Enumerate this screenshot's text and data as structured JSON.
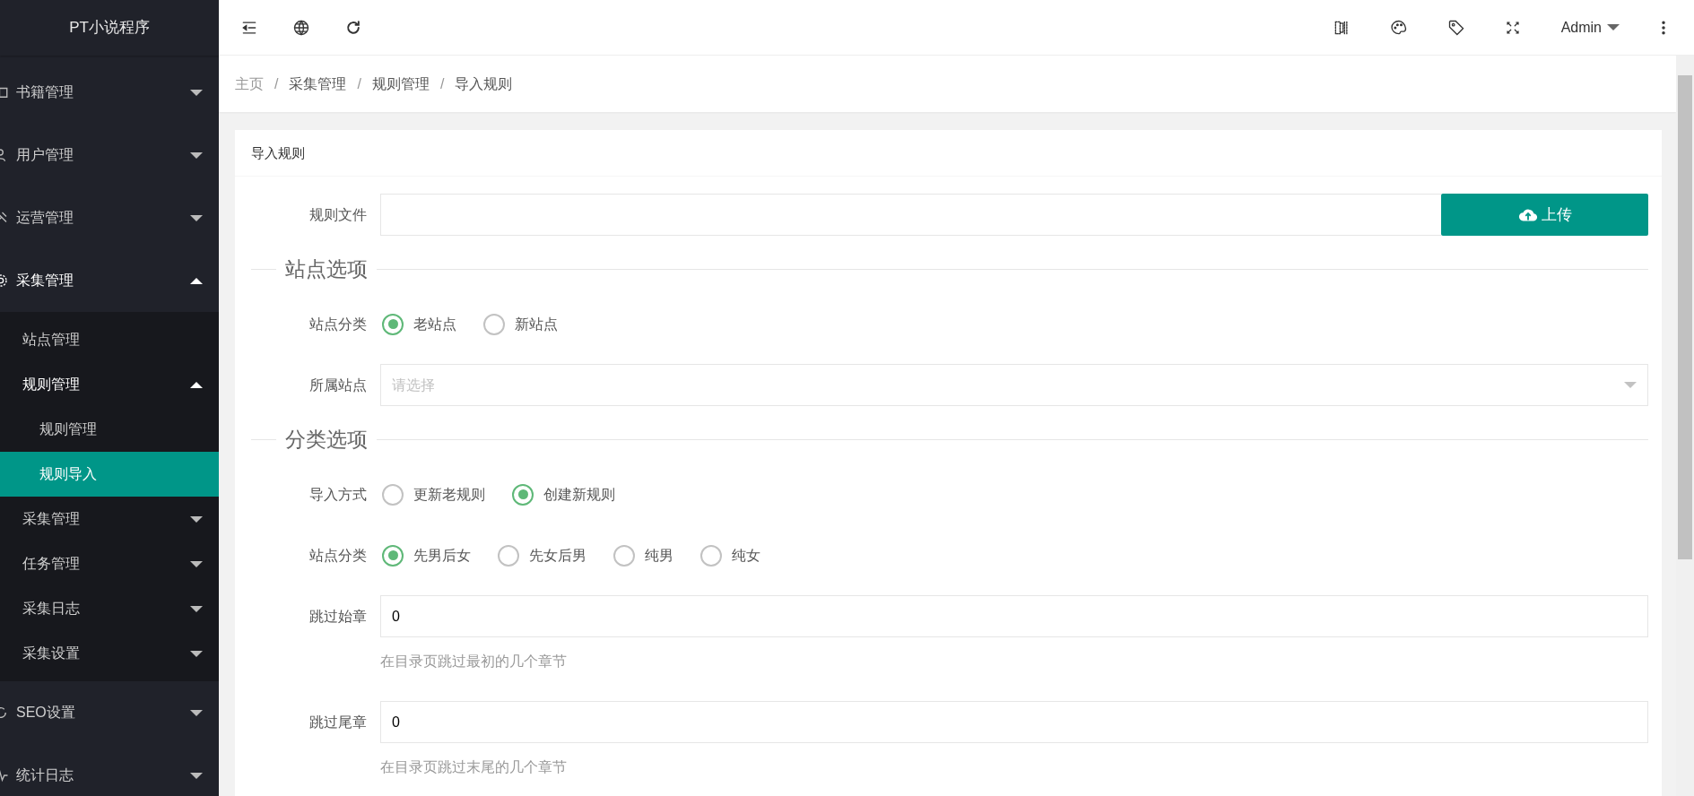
{
  "sidebar": {
    "title": "PT小说程序",
    "items": [
      {
        "label": "书籍管理",
        "expanded": false
      },
      {
        "label": "用户管理",
        "expanded": false
      },
      {
        "label": "运营管理",
        "expanded": false
      },
      {
        "label": "采集管理",
        "expanded": true,
        "children": [
          {
            "label": "站点管理",
            "selected": false
          },
          {
            "label": "规则管理",
            "expanded": true,
            "selected": false,
            "children": [
              {
                "label": "规则管理",
                "selected": false
              },
              {
                "label": "规则导入",
                "selected": true
              }
            ]
          },
          {
            "label": "采集管理",
            "expanded": false,
            "selected": false
          },
          {
            "label": "任务管理",
            "expanded": false,
            "selected": false
          },
          {
            "label": "采集日志",
            "expanded": false,
            "selected": false
          },
          {
            "label": "采集设置",
            "expanded": false,
            "selected": false
          }
        ]
      },
      {
        "label": "SEO设置",
        "expanded": false
      },
      {
        "label": "统计日志",
        "expanded": false
      }
    ]
  },
  "topbar": {
    "user": "Admin"
  },
  "breadcrumb": [
    {
      "label": "主页"
    },
    {
      "separator": "/",
      "label": "采集管理"
    },
    {
      "separator": "/",
      "label": "规则管理"
    },
    {
      "separator": "/",
      "label": "导入规则"
    }
  ],
  "card": {
    "title": "导入规则",
    "rows": [
      {
        "kind": "upload",
        "label": "规则文件",
        "button": "上传"
      },
      {
        "kind": "section",
        "label": "站点选项"
      },
      {
        "kind": "radio",
        "label": "站点分类",
        "options": [
          {
            "label": "老站点",
            "selected": true
          },
          {
            "label": "新站点",
            "selected": false
          }
        ]
      },
      {
        "kind": "select",
        "label": "所属站点",
        "placeholder": "请选择"
      },
      {
        "kind": "section",
        "label": "分类选项"
      },
      {
        "kind": "radio",
        "label": "导入方式",
        "options": [
          {
            "label": "更新老规则",
            "selected": false
          },
          {
            "label": "创建新规则",
            "selected": true
          }
        ]
      },
      {
        "kind": "radio",
        "label": "站点分类",
        "options": [
          {
            "label": "先男后女",
            "selected": true
          },
          {
            "label": "先女后男",
            "selected": false
          },
          {
            "label": "纯男",
            "selected": false
          },
          {
            "label": "纯女",
            "selected": false
          }
        ]
      },
      {
        "kind": "text",
        "label": "跳过始章",
        "value": "0",
        "help": "在目录页跳过最初的几个章节"
      },
      {
        "kind": "text",
        "label": "跳过尾章",
        "value": "0",
        "help": "在目录页跳过末尾的几个章节"
      }
    ]
  }
}
